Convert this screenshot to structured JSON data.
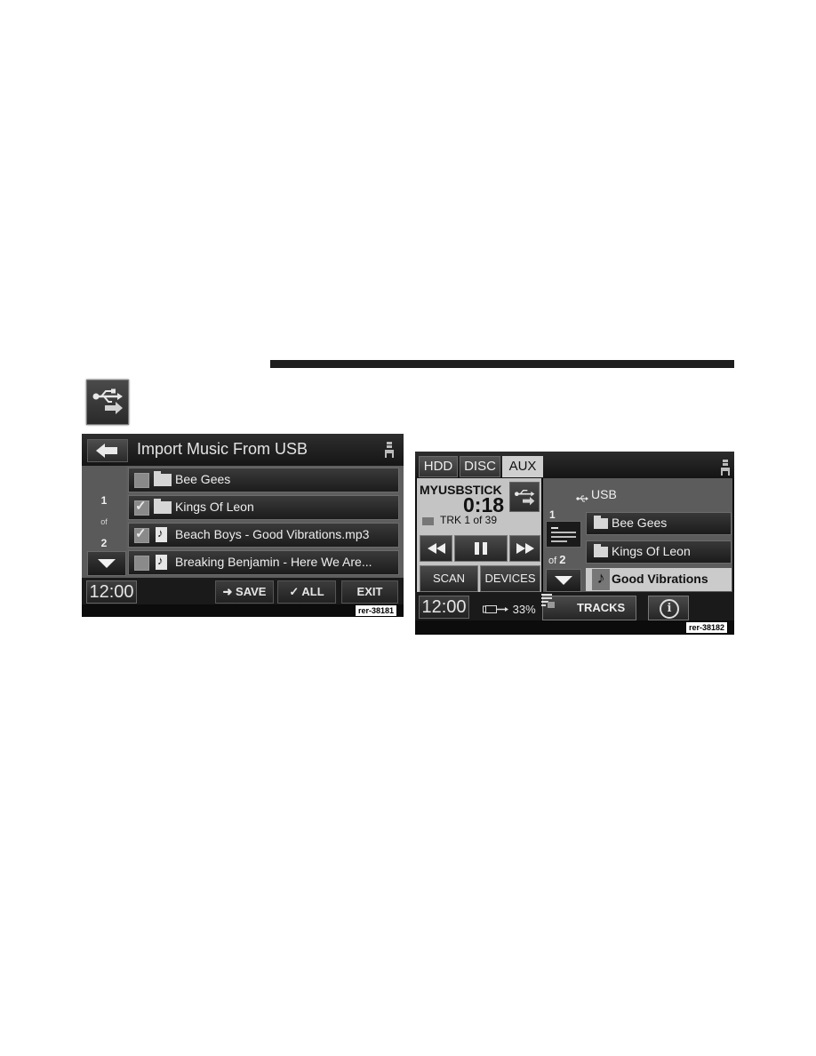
{
  "import_icon": "usb-import-icon",
  "import_screen": {
    "title": "Import Music From USB",
    "back_icon": "back-arrow-icon",
    "seat_icon": "seat-icon",
    "pager": {
      "current": "1",
      "of": "of",
      "total": "2"
    },
    "items": [
      {
        "label": "Bee Gees",
        "type": "folder",
        "checked": false
      },
      {
        "label": "Kings Of Leon",
        "type": "folder",
        "checked": true
      },
      {
        "label": "Beach Boys - Good Vibrations.mp3",
        "type": "file",
        "checked": true
      },
      {
        "label": "Breaking Benjamin - Here We Are...",
        "type": "file",
        "checked": false
      }
    ],
    "footer": {
      "clock": "12:00",
      "save_label": "SAVE",
      "all_label": "ALL",
      "exit_label": "EXIT"
    },
    "code": "rer-38181"
  },
  "player_screen": {
    "tabs": [
      {
        "label": "HDD",
        "active": false
      },
      {
        "label": "DISC",
        "active": false
      },
      {
        "label": "AUX",
        "active": true
      }
    ],
    "device_name": "MYUSBSTICK",
    "time": "0:18",
    "track": "TRK 1 of 39",
    "scan_label": "SCAN",
    "devices_label": "DEVICES",
    "source_label": "USB",
    "pager": {
      "current": "1",
      "of": "of",
      "total": "2"
    },
    "items": [
      {
        "label": "Bee Gees",
        "type": "folder",
        "selected": false
      },
      {
        "label": "Kings Of Leon",
        "type": "folder",
        "selected": false
      },
      {
        "label": "Good Vibrations",
        "type": "song",
        "selected": true
      }
    ],
    "footer": {
      "clock": "12:00",
      "battery": "33%",
      "tracks_label": "TRACKS",
      "info_label": "i"
    },
    "code": "rer-38182"
  },
  "colors": {
    "screen_bg": "#0c0c0c",
    "panel_gray": "#5e5e5e",
    "light_panel": "#c4c4c4",
    "rule": "#1e1e1e"
  }
}
